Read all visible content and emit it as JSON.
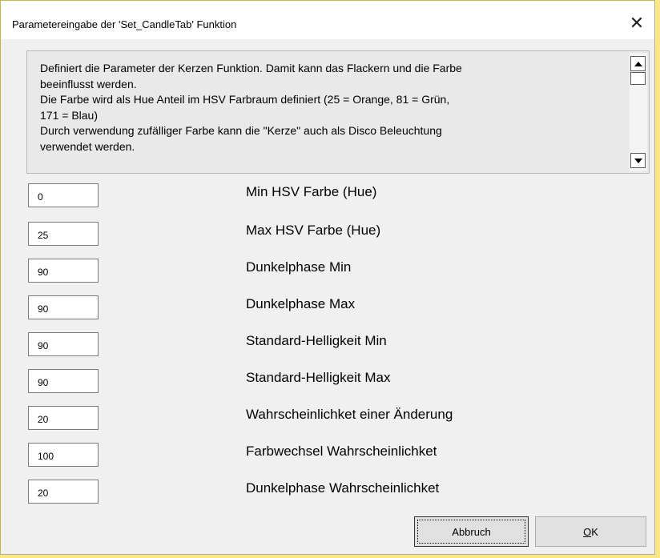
{
  "window": {
    "title": "Parametereingabe der 'Set_CandleTab' Funktion",
    "close_glyph": "✕"
  },
  "description": {
    "text": "Definiert die Parameter der Kerzen Funktion. Damit kann das Flackern und die Farbe\nbeeinflusst werden.\nDie Farbe wird als Hue Anteil im HSV Farbraum definiert (25 = Orange, 81 = Grün,\n171 = Blau)\nDurch verwendung zufälliger Farbe kann die \"Kerze\" auch als Disco Beleuchtung\nverwendet werden."
  },
  "params": [
    {
      "value": "0",
      "label": "Min HSV Farbe (Hue)"
    },
    {
      "value": "25",
      "label": "Max HSV Farbe (Hue)"
    },
    {
      "value": "90",
      "label": "Dunkelphase Min"
    },
    {
      "value": "90",
      "label": "Dunkelphase Max"
    },
    {
      "value": "90",
      "label": "Standard-Helligkeit Min"
    },
    {
      "value": "90",
      "label": "Standard-Helligkeit Max"
    },
    {
      "value": "20",
      "label": "Wahrscheinlichket einer Änderung"
    },
    {
      "value": "100",
      "label": "Farbwechsel Wahrscheinlichket"
    },
    {
      "value": "20",
      "label": "Dunkelphase Wahrscheinlichket"
    }
  ],
  "buttons": {
    "cancel_label": "Abbruch",
    "ok_first": "O",
    "ok_rest": "K"
  },
  "colors": {
    "background": "#fbe785",
    "dialog": "#f0f0f0",
    "button": "#e1e1e1"
  }
}
